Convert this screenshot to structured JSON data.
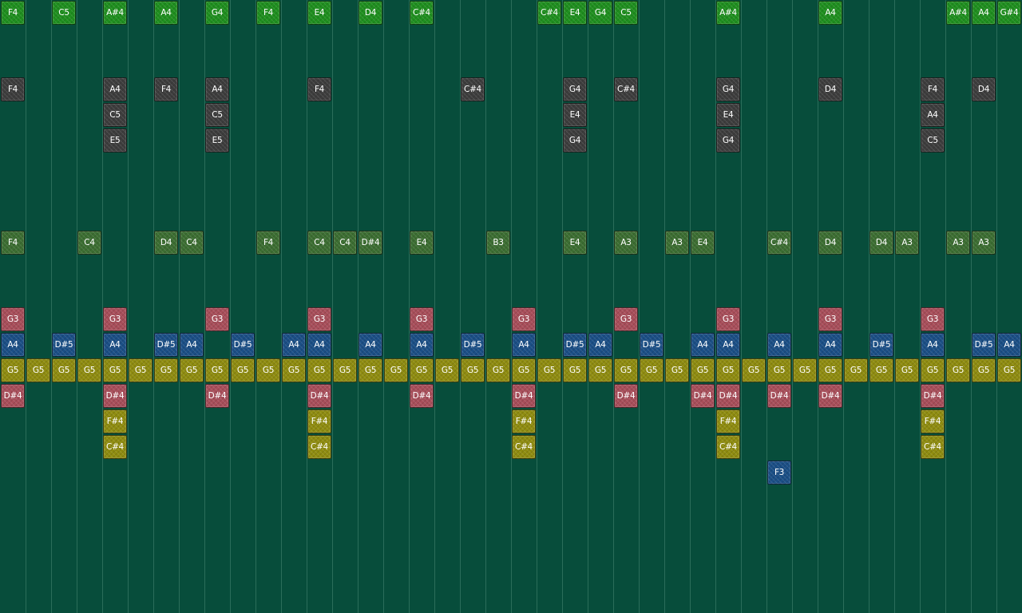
{
  "colors": {
    "background": "#074d3b",
    "grid_line": "#2b6d5a",
    "lanes": {
      "melody": "#1f8f1f",
      "harmony": "#3d3d3d",
      "counter": "#3c6e32",
      "accent": "#a84e5a",
      "bass": "#1b4f86",
      "pulse": "#8f8c10",
      "low": "#a84e5a",
      "low2": "#8f8c10",
      "deep": "#1b4f86"
    }
  },
  "columns": 40,
  "rows": [
    {
      "lane": "melody",
      "notes": [
        [
          0,
          "F4"
        ],
        [
          2,
          "C5"
        ],
        [
          4,
          "A#4"
        ],
        [
          6,
          "A4"
        ],
        [
          8,
          "G4"
        ],
        [
          10,
          "F4"
        ],
        [
          12,
          "E4"
        ],
        [
          14,
          "D4"
        ],
        [
          16,
          "C#4"
        ],
        [
          21,
          "C#4"
        ],
        [
          22,
          "E4"
        ],
        [
          23,
          "G4"
        ],
        [
          24,
          "C5"
        ],
        [
          28,
          "A#4"
        ],
        [
          32,
          "A4"
        ],
        [
          37,
          "A#4"
        ],
        [
          38,
          "A4"
        ],
        [
          39,
          "G#4"
        ]
      ]
    },
    {
      "lane": "harmony",
      "notes": [
        [
          0,
          "F4"
        ],
        [
          4,
          "A4"
        ],
        [
          6,
          "F4"
        ],
        [
          8,
          "A4"
        ],
        [
          12,
          "F4"
        ],
        [
          18,
          "C#4"
        ],
        [
          22,
          "G4"
        ],
        [
          24,
          "C#4"
        ],
        [
          28,
          "G4"
        ],
        [
          32,
          "D4"
        ],
        [
          36,
          "F4"
        ],
        [
          38,
          "D4"
        ]
      ]
    },
    {
      "lane": "harmony",
      "notes": [
        [
          4,
          "C5"
        ],
        [
          8,
          "C5"
        ],
        [
          22,
          "E4"
        ],
        [
          28,
          "E4"
        ],
        [
          36,
          "A4"
        ]
      ]
    },
    {
      "lane": "harmony",
      "notes": [
        [
          4,
          "E5"
        ],
        [
          8,
          "E5"
        ],
        [
          22,
          "G4"
        ],
        [
          28,
          "G4"
        ],
        [
          36,
          "C5"
        ]
      ]
    },
    {
      "lane": "counter",
      "notes": [
        [
          0,
          "F4"
        ],
        [
          3,
          "C4"
        ],
        [
          6,
          "D4"
        ],
        [
          7,
          "C4"
        ],
        [
          10,
          "F4"
        ],
        [
          12,
          "C4"
        ],
        [
          13,
          "C4"
        ],
        [
          14,
          "D#4"
        ],
        [
          16,
          "E4"
        ],
        [
          19,
          "B3"
        ],
        [
          22,
          "E4"
        ],
        [
          24,
          "A3"
        ],
        [
          26,
          "A3"
        ],
        [
          27,
          "E4"
        ],
        [
          30,
          "C#4"
        ],
        [
          32,
          "D4"
        ],
        [
          34,
          "D4"
        ],
        [
          35,
          "A3"
        ],
        [
          37,
          "A3"
        ],
        [
          38,
          "A3"
        ]
      ]
    },
    {
      "lane": "accent",
      "notes": [
        [
          0,
          "G3"
        ],
        [
          4,
          "G3"
        ],
        [
          8,
          "G3"
        ],
        [
          12,
          "G3"
        ],
        [
          16,
          "G3"
        ],
        [
          20,
          "G3"
        ],
        [
          24,
          "G3"
        ],
        [
          28,
          "G3"
        ],
        [
          32,
          "G3"
        ],
        [
          36,
          "G3"
        ]
      ]
    },
    {
      "lane": "bass",
      "notes": [
        [
          0,
          "A4"
        ],
        [
          2,
          "D#5"
        ],
        [
          4,
          "A4"
        ],
        [
          6,
          "D#5"
        ],
        [
          7,
          "A4"
        ],
        [
          9,
          "D#5"
        ],
        [
          11,
          "A4"
        ],
        [
          12,
          "A4"
        ],
        [
          14,
          "A4"
        ],
        [
          16,
          "A4"
        ],
        [
          18,
          "D#5"
        ],
        [
          20,
          "A4"
        ],
        [
          22,
          "D#5"
        ],
        [
          23,
          "A4"
        ],
        [
          25,
          "D#5"
        ],
        [
          27,
          "A4"
        ],
        [
          28,
          "A4"
        ],
        [
          30,
          "A4"
        ],
        [
          32,
          "A4"
        ],
        [
          34,
          "D#5"
        ],
        [
          36,
          "A4"
        ],
        [
          38,
          "D#5"
        ],
        [
          39,
          "A4"
        ]
      ]
    },
    {
      "lane": "pulse",
      "notes": [
        [
          0,
          "G5"
        ],
        [
          1,
          "G5"
        ],
        [
          2,
          "G5"
        ],
        [
          3,
          "G5"
        ],
        [
          4,
          "G5"
        ],
        [
          5,
          "G5"
        ],
        [
          6,
          "G5"
        ],
        [
          7,
          "G5"
        ],
        [
          8,
          "G5"
        ],
        [
          9,
          "G5"
        ],
        [
          10,
          "G5"
        ],
        [
          11,
          "G5"
        ],
        [
          12,
          "G5"
        ],
        [
          13,
          "G5"
        ],
        [
          14,
          "G5"
        ],
        [
          15,
          "G5"
        ],
        [
          16,
          "G5"
        ],
        [
          17,
          "G5"
        ],
        [
          18,
          "G5"
        ],
        [
          19,
          "G5"
        ],
        [
          20,
          "G5"
        ],
        [
          21,
          "G5"
        ],
        [
          22,
          "G5"
        ],
        [
          23,
          "G5"
        ],
        [
          24,
          "G5"
        ],
        [
          25,
          "G5"
        ],
        [
          26,
          "G5"
        ],
        [
          27,
          "G5"
        ],
        [
          28,
          "G5"
        ],
        [
          29,
          "G5"
        ],
        [
          30,
          "G5"
        ],
        [
          31,
          "G5"
        ],
        [
          32,
          "G5"
        ],
        [
          33,
          "G5"
        ],
        [
          34,
          "G5"
        ],
        [
          35,
          "G5"
        ],
        [
          36,
          "G5"
        ],
        [
          37,
          "G5"
        ],
        [
          38,
          "G5"
        ],
        [
          39,
          "G5"
        ]
      ]
    },
    {
      "lane": "low",
      "notes": [
        [
          0,
          "D#4"
        ],
        [
          4,
          "D#4"
        ],
        [
          8,
          "D#4"
        ],
        [
          12,
          "D#4"
        ],
        [
          16,
          "D#4"
        ],
        [
          20,
          "D#4"
        ],
        [
          24,
          "D#4"
        ],
        [
          27,
          "D#4"
        ],
        [
          28,
          "D#4"
        ],
        [
          30,
          "D#4"
        ],
        [
          32,
          "D#4"
        ],
        [
          36,
          "D#4"
        ]
      ]
    },
    {
      "lane": "low2",
      "notes": [
        [
          4,
          "F#4"
        ],
        [
          12,
          "F#4"
        ],
        [
          20,
          "F#4"
        ],
        [
          28,
          "F#4"
        ],
        [
          36,
          "F#4"
        ]
      ]
    },
    {
      "lane": "low2",
      "notes": [
        [
          4,
          "C#4"
        ],
        [
          12,
          "C#4"
        ],
        [
          20,
          "C#4"
        ],
        [
          28,
          "C#4"
        ],
        [
          36,
          "C#4"
        ]
      ]
    },
    {
      "lane": "deep",
      "notes": [
        [
          30,
          "F3"
        ]
      ]
    }
  ]
}
